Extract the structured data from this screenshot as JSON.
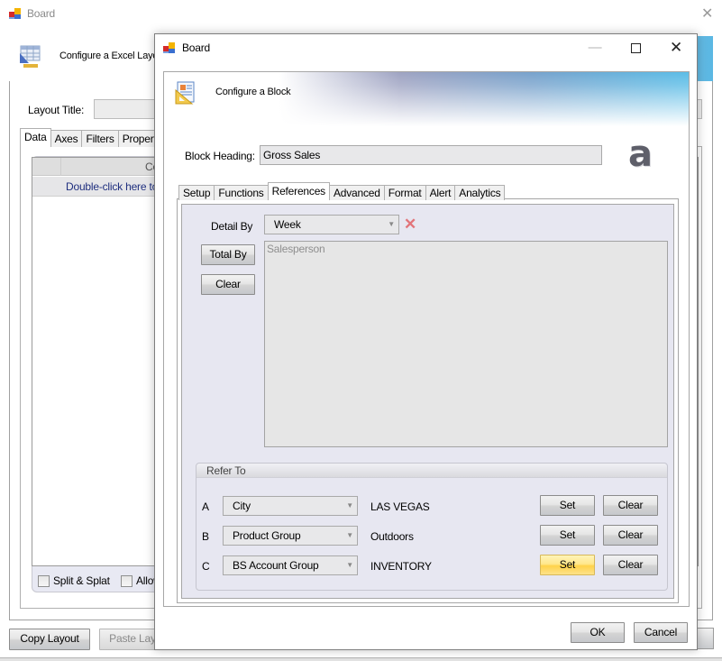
{
  "background_window": {
    "title": "Board",
    "close_glyph": "✕",
    "header_text": "Configure a Excel Layout",
    "layout_title_label": "Layout Title:",
    "layout_title_value": "",
    "tabs": [
      {
        "label": "Data",
        "active": true
      },
      {
        "label": "Axes",
        "active": false
      },
      {
        "label": "Filters",
        "active": false
      },
      {
        "label": "Properties",
        "active": false
      }
    ],
    "grid": {
      "column_header": "Columns",
      "hint_row": "Double-click here to add"
    },
    "checkboxes": [
      {
        "label": "Split & Splat",
        "checked": false
      },
      {
        "label": "Allow",
        "checked": false
      }
    ],
    "buttons": {
      "copy_layout": "Copy Layout",
      "paste_layout": "Paste Layout"
    }
  },
  "dialog": {
    "title": "Board",
    "window_controls": {
      "minimize": "—",
      "close": "✕"
    },
    "header_text": "Configure a Block",
    "block_heading_label": "Block Heading:",
    "block_heading_value": "Gross Sales",
    "logo_glyph": "a",
    "tabs": [
      {
        "label": "Setup",
        "active": false
      },
      {
        "label": "Functions",
        "active": false
      },
      {
        "label": "References",
        "active": true
      },
      {
        "label": "Advanced",
        "active": false
      },
      {
        "label": "Format",
        "active": false
      },
      {
        "label": "Alert",
        "active": false
      },
      {
        "label": "Analytics",
        "active": false
      }
    ],
    "references": {
      "detail_by_label": "Detail By",
      "detail_by_value": "Week",
      "clear_icon_glyph": "✕",
      "total_by_button": "Total By",
      "clear_button": "Clear",
      "total_by_items": [
        "Salesperson"
      ],
      "refer_to": {
        "title": "Refer To",
        "rows": [
          {
            "letter": "A",
            "field": "City",
            "value": "LAS VEGAS",
            "set_label": "Set",
            "clear_label": "Clear",
            "set_highlighted": false
          },
          {
            "letter": "B",
            "field": "Product Group",
            "value": "Outdoors",
            "set_label": "Set",
            "clear_label": "Clear",
            "set_highlighted": false
          },
          {
            "letter": "C",
            "field": "BS Account Group",
            "value": "INVENTORY",
            "set_label": "Set",
            "clear_label": "Clear",
            "set_highlighted": true
          }
        ]
      }
    },
    "ok_button": "OK",
    "cancel_button": "Cancel"
  },
  "colors": {
    "highlight_button": "#ffd24a",
    "panel_background": "#e7e7f1",
    "header_gradient_end": "#5bbde7",
    "clear_x": "#e2747a"
  }
}
